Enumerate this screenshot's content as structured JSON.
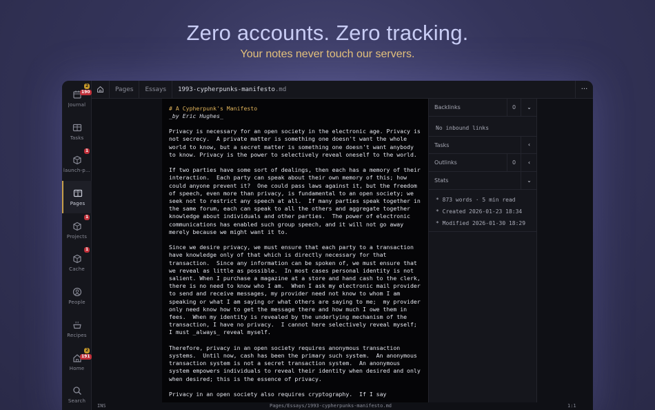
{
  "hero": {
    "title": "Zero accounts. Zero tracking.",
    "subtitle": "Your notes never touch our servers."
  },
  "sidebar": {
    "items": [
      {
        "label": "Journal",
        "icon": "calendar-icon",
        "badge_top": "2",
        "badge_bottom": "190"
      },
      {
        "label": "Tasks",
        "icon": "board-icon"
      },
      {
        "label": "launch-p…",
        "icon": "cube-icon",
        "badge_top": "1"
      },
      {
        "label": "Pages",
        "icon": "book-icon"
      },
      {
        "label": "Projects",
        "icon": "cube-icon",
        "badge_top": "1"
      },
      {
        "label": "Cache",
        "icon": "cube-icon",
        "badge_top": "1"
      },
      {
        "label": "People",
        "icon": "person-icon"
      },
      {
        "label": "Recipes",
        "icon": "pot-icon"
      },
      {
        "label": "Home",
        "icon": "house-icon",
        "badge_top": "2",
        "badge_bottom": "191"
      },
      {
        "label": "Search",
        "icon": "search-icon"
      }
    ]
  },
  "breadcrumb": {
    "pages": "Pages",
    "essays": "Essays",
    "file_name": "1993-cypherpunks-manifesto",
    "file_ext": ".md",
    "more": "···"
  },
  "editor": {
    "lines": [
      {
        "n": "1",
        "text": "# A Cypherpunk's Manifesto",
        "style": "h1"
      },
      {
        "n": "2",
        "text": "_by Eric Hughes_",
        "style": "em"
      },
      {
        "n": "3",
        "text": ""
      },
      {
        "n": "4",
        "text": "Privacy is necessary for an open society in the electronic age. Privacy is"
      },
      {
        "n": "↳",
        "text": "not secrecy.  A private matter is something one doesn't want the whole"
      },
      {
        "n": "↳",
        "text": "world to know, but a secret matter is something one doesn't want anybody"
      },
      {
        "n": "↳",
        "text": "to know. Privacy is the power to selectively reveal oneself to the world."
      },
      {
        "n": "5",
        "text": ""
      },
      {
        "n": "6",
        "text": "If two parties have some sort of dealings, then each has a memory of their"
      },
      {
        "n": "↳",
        "text": "interaction.  Each party can speak about their own memory of this; how"
      },
      {
        "n": "↳",
        "text": "could anyone prevent it?  One could pass laws against it, but the freedom"
      },
      {
        "n": "↳",
        "text": "of speech, even more than privacy, is fundamental to an open society; we"
      },
      {
        "n": "↳",
        "text": "seek not to restrict any speech at all.  If many parties speak together in"
      },
      {
        "n": "↳",
        "text": "the same forum, each can speak to all the others and aggregate together"
      },
      {
        "n": "↳",
        "text": "knowledge about individuals and other parties.  The power of electronic"
      },
      {
        "n": "↳",
        "text": "communications has enabled such group speech, and it will not go away"
      },
      {
        "n": "↳",
        "text": "merely because we might want it to."
      },
      {
        "n": "7",
        "text": ""
      },
      {
        "n": "8",
        "text": "Since we desire privacy, we must ensure that each party to a transaction"
      },
      {
        "n": "↳",
        "text": "have knowledge only of that which is directly necessary for that"
      },
      {
        "n": "↳",
        "text": "transaction.  Since any information can be spoken of, we must ensure that"
      },
      {
        "n": "↳",
        "text": "we reveal as little as possible.  In most cases personal identity is not"
      },
      {
        "n": "↳",
        "text": "salient. When I purchase a magazine at a store and hand cash to the clerk,"
      },
      {
        "n": "↳",
        "text": "there is no need to know who I am.  When I ask my electronic mail provider"
      },
      {
        "n": "↳",
        "text": "to send and receive messages, my provider need not know to whom I am"
      },
      {
        "n": "↳",
        "text": "speaking or what I am saying or what others are saying to me;  my provider"
      },
      {
        "n": "↳",
        "text": "only need know how to get the message there and how much I owe them in"
      },
      {
        "n": "↳",
        "text": "fees.  When my identity is revealed by the underlying mechanism of the"
      },
      {
        "n": "↳",
        "text": "transaction, I have no privacy.  I cannot here selectively reveal myself;"
      },
      {
        "n": "↳",
        "text": "I must _always_ reveal myself."
      },
      {
        "n": "9",
        "text": ""
      },
      {
        "n": "10",
        "text": "Therefore, privacy in an open society requires anonymous transaction"
      },
      {
        "n": "↳",
        "text": "systems.  Until now, cash has been the primary such system.  An anonymous"
      },
      {
        "n": "↳",
        "text": "transaction system is not a secret transaction system.  An anonymous"
      },
      {
        "n": "↳",
        "text": "system empowers individuals to reveal their identity when desired and only"
      },
      {
        "n": "↳",
        "text": "when desired; this is the essence of privacy."
      },
      {
        "n": "11",
        "text": ""
      },
      {
        "n": "12",
        "text": "Privacy in an open society also requires cryptography.  If I say"
      }
    ]
  },
  "panel": {
    "backlinks": {
      "label": "Backlinks",
      "count": "0",
      "empty": "No inbound links"
    },
    "tasks": {
      "label": "Tasks"
    },
    "outlinks": {
      "label": "Outlinks",
      "count": "0"
    },
    "stats": {
      "label": "Stats",
      "words": "* 873 words · 5 min read",
      "created": "* Created 2026-01-23 18:34",
      "modified": "* Modified 2026-01-30 18:29"
    }
  },
  "status": {
    "mode": "INS",
    "path": "Pages/Essays/1993-cypherpunks-manifesto.md",
    "position": "1:1"
  },
  "colors": {
    "accent": "#e0b35a",
    "badge_red": "#c0303a",
    "badge_yellow": "#c89a2a"
  }
}
